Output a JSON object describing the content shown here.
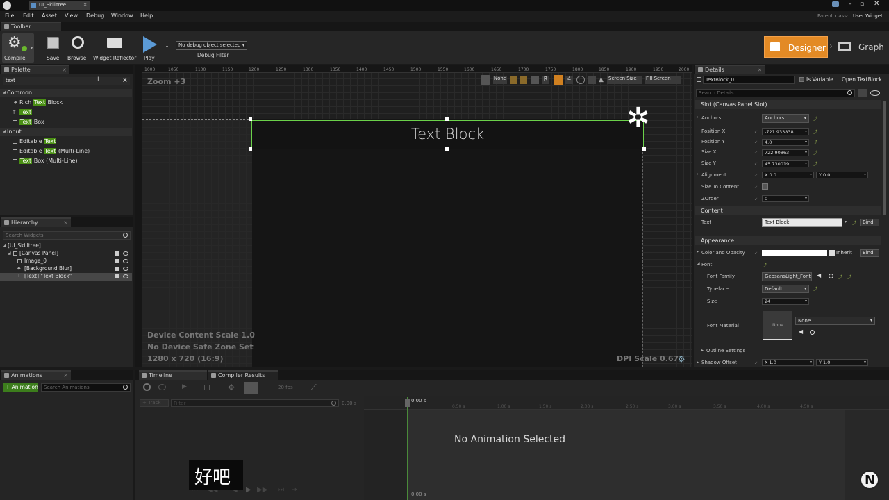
{
  "window": {
    "tab_title": "UI_Skilltree",
    "parent_class_label": "Parent class:",
    "parent_class_value": "User Widget"
  },
  "menu": [
    "File",
    "Edit",
    "Asset",
    "View",
    "Debug",
    "Window",
    "Help"
  ],
  "toolbar": {
    "tab_label": "Toolbar",
    "compile": "Compile",
    "save": "Save",
    "browse": "Browse",
    "widget_reflector": "Widget Reflector",
    "play": "Play",
    "debug_dropdown": "No debug object selected",
    "debug_filter": "Debug Filter",
    "designer": "Designer",
    "graph": "Graph"
  },
  "palette": {
    "tab_label": "Palette",
    "search_value": "text",
    "categories": [
      {
        "label": "Common",
        "items": [
          {
            "pre": "Rich ",
            "hl": "Text",
            "post": " Block"
          },
          {
            "pre": "",
            "hl": "Text",
            "post": ""
          },
          {
            "pre": "",
            "hl": "Text",
            "post": " Box"
          }
        ]
      },
      {
        "label": "Input",
        "items": [
          {
            "pre": "Editable ",
            "hl": "Text",
            "post": ""
          },
          {
            "pre": "Editable ",
            "hl": "Text",
            "post": " (Multi-Line)"
          },
          {
            "pre": "",
            "hl": "Text",
            "post": " Box (Multi-Line)"
          }
        ]
      }
    ]
  },
  "hierarchy": {
    "tab_label": "Hierarchy",
    "search_placeholder": "Search Widgets",
    "items": [
      "[UI_Skilltree]",
      "[Canvas Panel]",
      "Image_0",
      "[Background Blur]",
      "[Text] \"Text Block\""
    ]
  },
  "designer": {
    "zoom": "Zoom +3",
    "none_label": "None",
    "r_label": "R",
    "num_4": "4",
    "screen_size": "Screen Size",
    "fill_screen": "Fill Screen",
    "ruler": [
      "1000",
      "1050",
      "1100",
      "1150",
      "1200",
      "1250",
      "1300",
      "1350",
      "1400",
      "1450",
      "1500",
      "1550",
      "1600",
      "1650",
      "1700",
      "1750",
      "1800",
      "1850",
      "1900",
      "1950",
      "2000"
    ],
    "text_block": "Text Block",
    "device_scale": "Device Content Scale 1.0",
    "safe_zone": "No Device Safe Zone Set",
    "resolution": "1280 x 720 (16:9)",
    "dpi_scale": "DPI Scale 0.67"
  },
  "details": {
    "tab_label": "Details",
    "name_value": "TextBlock_0",
    "is_variable": "Is Variable",
    "open_link": "Open TextBlock",
    "search_placeholder": "Search Details",
    "slot_section": "Slot (Canvas Panel Slot)",
    "anchors_label": "Anchors",
    "anchors_value": "Anchors",
    "position_x_label": "Position X",
    "position_x": "-721.933838",
    "position_y_label": "Position Y",
    "position_y": "4.0",
    "size_x_label": "Size X",
    "size_x": "722.90863",
    "size_y_label": "Size Y",
    "size_y": "45.730019",
    "alignment_label": "Alignment",
    "alignment_x": "X 0.0",
    "alignment_y": "Y 0.0",
    "size_to_content_label": "Size To Content",
    "zorder_label": "ZOrder",
    "zorder": "0",
    "content_section": "Content",
    "text_label": "Text",
    "text_value": "Text Block",
    "bind": "Bind",
    "appearance_section": "Appearance",
    "color_label": "Color and Opacity",
    "inherit": "Inherit",
    "font_label": "Font",
    "font_family_label": "Font Family",
    "font_family": "GeosansLight_Font",
    "typeface_label": "Typeface",
    "typeface": "Default",
    "size_label": "Size",
    "size": "24",
    "font_material_label": "Font Material",
    "font_material_thumb": "None",
    "font_material_value": "None",
    "outline_settings": "Outline Settings",
    "shadow_offset_label": "Shadow Offset",
    "shadow_x": "X 1.0",
    "shadow_y": "Y 1.0"
  },
  "animations": {
    "tab_label": "Animations",
    "add_button": "+ Animation",
    "search_placeholder": "Search Animations"
  },
  "timeline": {
    "tab_timeline": "Timeline",
    "tab_compiler": "Compiler Results",
    "fps": "20 fps",
    "track": "+ Track",
    "filter_placeholder": "Filter",
    "time_left": "0.00 s",
    "time_top": "0.00 s",
    "time_bottom": "0.00 s",
    "ticks": [
      "0.50 s",
      "1.00 s",
      "1.50 s",
      "2.00 s",
      "2.50 s",
      "3.00 s",
      "3.50 s",
      "4.00 s",
      "4.50 s"
    ],
    "no_animation": "No Animation Selected"
  },
  "subtitle": "好吧"
}
